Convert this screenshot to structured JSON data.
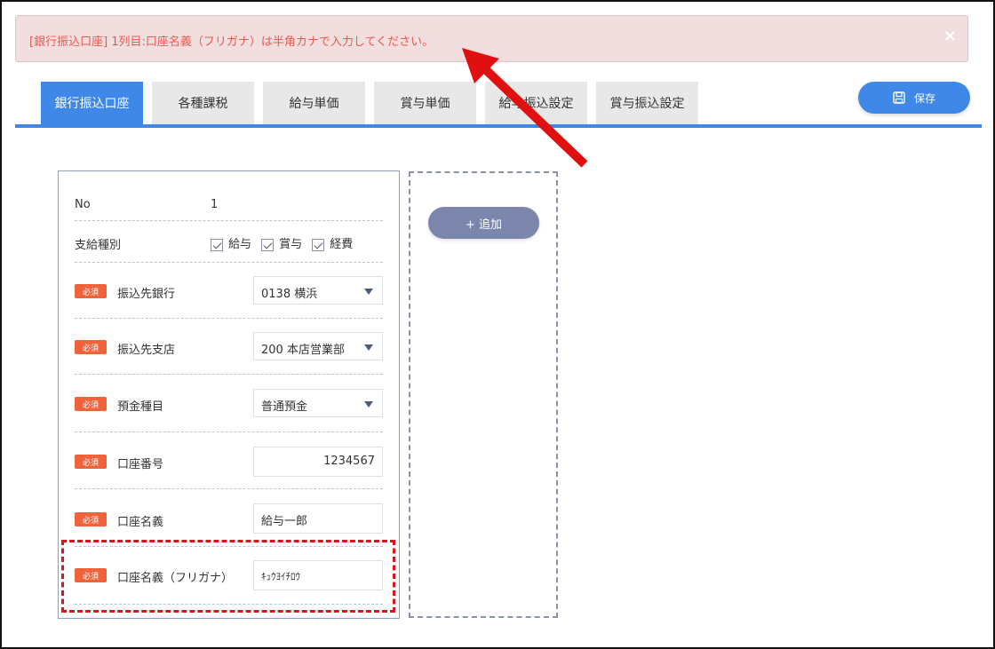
{
  "alert": {
    "message": "[銀行振込口座] 1列目:口座名義（フリガナ）は半角カナで入力してください。",
    "close": "×"
  },
  "tabs": [
    {
      "label": "銀行振込口座",
      "active": true
    },
    {
      "label": "各種課税",
      "active": false
    },
    {
      "label": "給与単価",
      "active": false
    },
    {
      "label": "賞与単価",
      "active": false
    },
    {
      "label": "給与振込設定",
      "active": false
    },
    {
      "label": "賞与振込設定",
      "active": false
    }
  ],
  "save_button": {
    "label": "保存",
    "icon": "save-icon"
  },
  "form": {
    "no": {
      "label": "No",
      "value": "1"
    },
    "payment_type": {
      "label": "支給種別",
      "options": [
        {
          "label": "給与",
          "checked": true
        },
        {
          "label": "賞与",
          "checked": true
        },
        {
          "label": "経費",
          "checked": true
        }
      ]
    },
    "required_badge": "必須",
    "bank": {
      "label": "振込先銀行",
      "value": "0138 横浜"
    },
    "branch": {
      "label": "振込先支店",
      "value": "200 本店営業部"
    },
    "account_type": {
      "label": "預金種目",
      "value": "普通預金"
    },
    "account_number": {
      "label": "口座番号",
      "value": "1234567"
    },
    "account_name": {
      "label": "口座名義",
      "value": "給与一郎"
    },
    "account_name_kana": {
      "label": "口座名義（フリガナ）",
      "value": "ｷｭｳﾖｲﾁﾛｳ"
    }
  },
  "add_button": {
    "label": "+ 追加"
  },
  "colors": {
    "primary": "#3f88e8",
    "alert_bg": "#f2dede",
    "alert_text": "#e85a4f",
    "required": "#f0623a",
    "annotation": "#d9141d"
  }
}
